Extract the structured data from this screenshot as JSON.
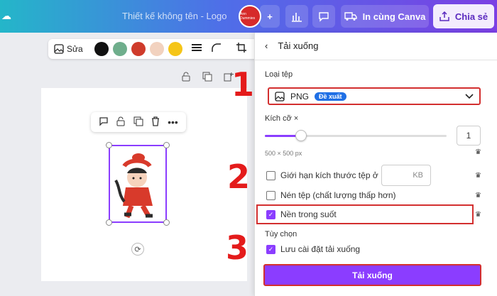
{
  "topbar": {
    "title": "Thiết kế không tên - Logo",
    "avatar_text": "Ann Dummies",
    "print_label": "In cùng Canva",
    "share_label": "Chia sẻ"
  },
  "toolbar": {
    "edit_label": "Sửa",
    "colors": [
      "#111111",
      "#6fae8c",
      "#cf3b2b",
      "#f2d2bf",
      "#f5c518"
    ]
  },
  "panel": {
    "title": "Tải xuống",
    "file_type_label": "Loại tệp",
    "file_type_value": "PNG",
    "file_type_badge": "Đề xuất",
    "size_label": "Kích cỡ ×",
    "size_value": "1",
    "size_fraction": 0.2,
    "dimensions": "500 × 500 px",
    "limit_label": "Giới hạn kích thước tệp ở",
    "limit_unit": "KB",
    "compress_label": "Nén tệp (chất lượng thấp hơn)",
    "transparent_label": "Nền trong suốt",
    "options_label": "Tùy chọn",
    "save_settings_label": "Lưu cài đặt tải xuống",
    "download_button": "Tải xuống"
  },
  "annotations": {
    "step1": "1",
    "step2": "2",
    "step3": "3"
  }
}
